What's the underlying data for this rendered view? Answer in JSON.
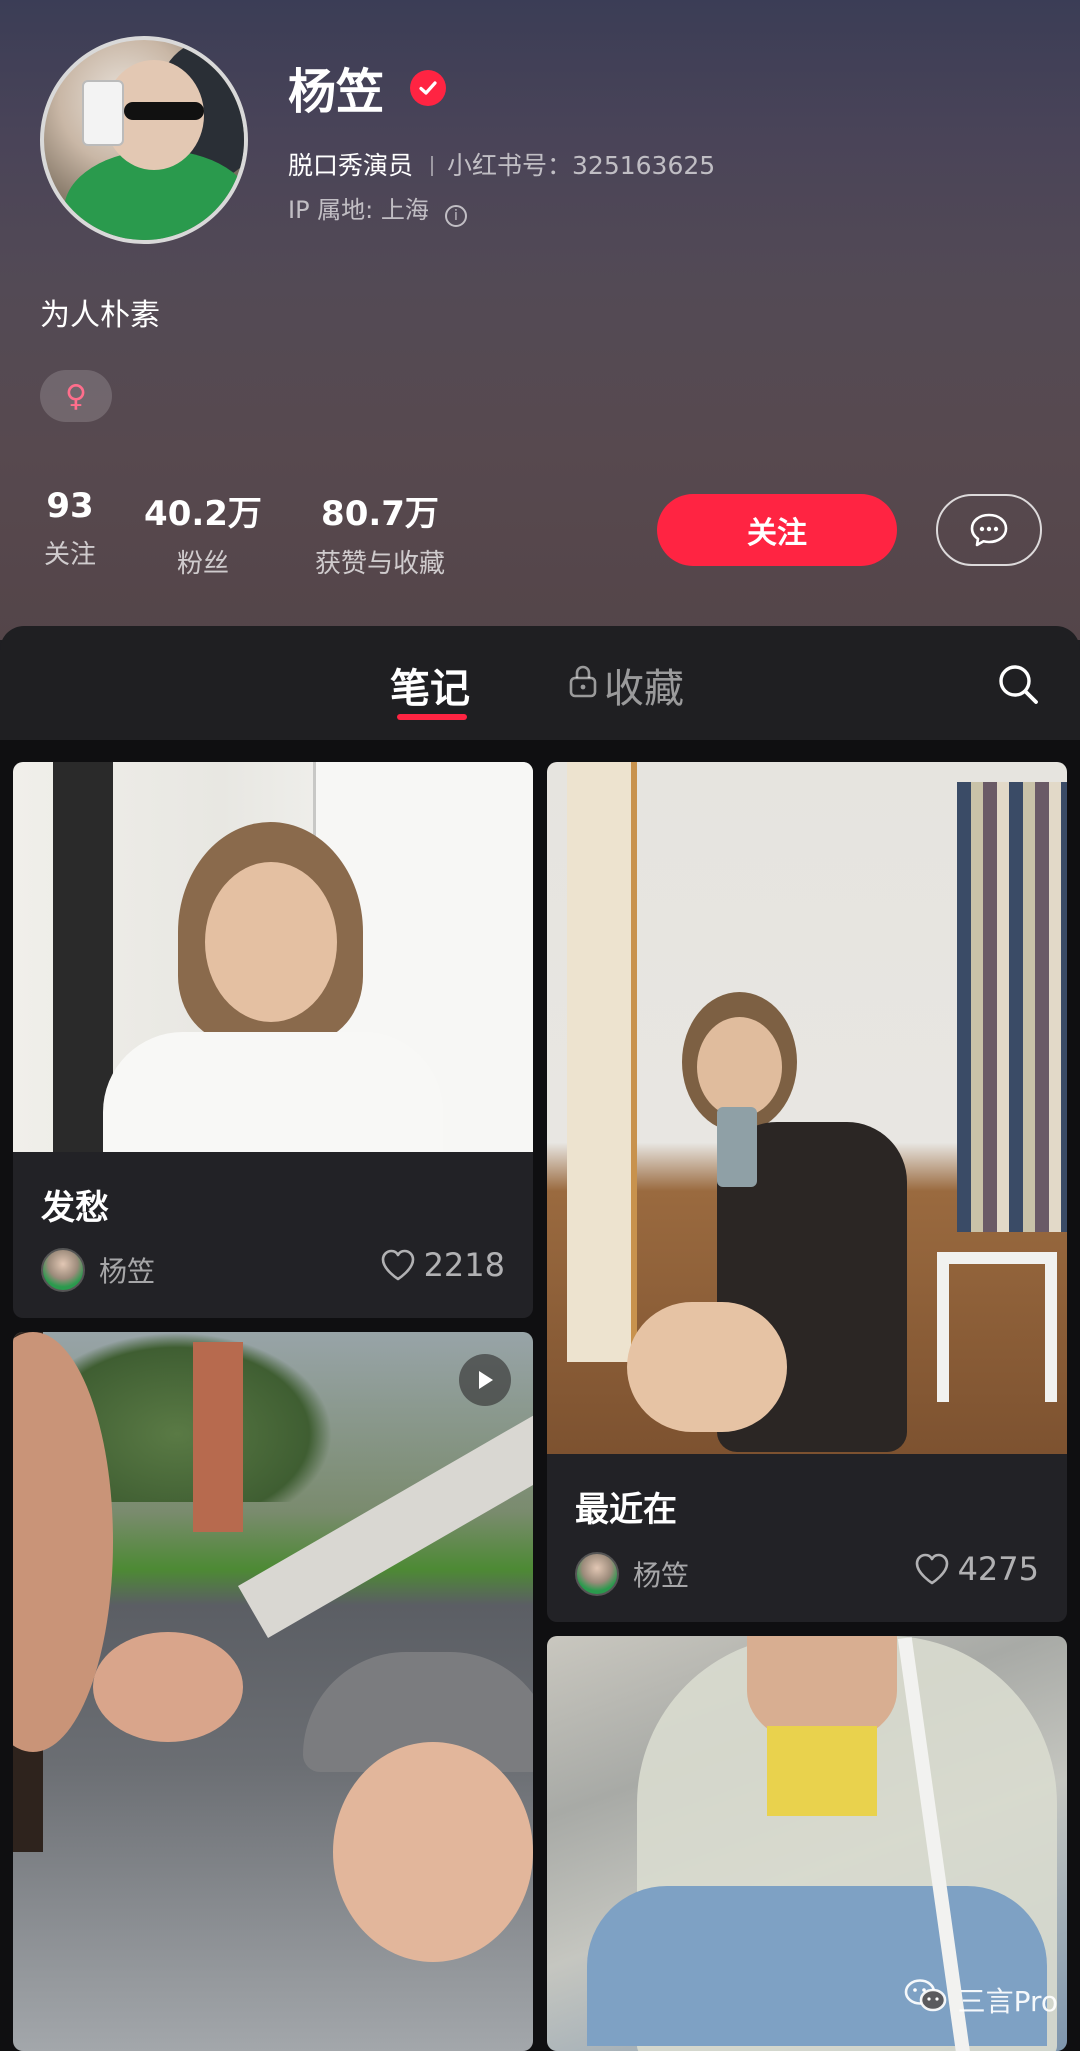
{
  "profile": {
    "name": "杨笠",
    "title": "脱口秀演员",
    "id_label": "小红书号：325163625",
    "ip_location": "IP 属地: 上海",
    "bio": "为人朴素",
    "gender_symbol": "♀"
  },
  "stats": [
    {
      "value": "93",
      "label": "关注"
    },
    {
      "value": "40.2万",
      "label": "粉丝"
    },
    {
      "value": "80.7万",
      "label": "获赞与收藏"
    }
  ],
  "actions": {
    "follow_label": "关注"
  },
  "tabs": {
    "notes": "笔记",
    "collections": "收藏"
  },
  "posts": [
    {
      "title": "发愁",
      "author": "杨笠",
      "likes": "2218",
      "type": "image"
    },
    {
      "title": "最近在",
      "author": "杨笠",
      "likes": "4275",
      "type": "image"
    },
    {
      "title": "",
      "author": "",
      "likes": "",
      "type": "video"
    },
    {
      "title": "",
      "author": "",
      "likes": "",
      "type": "image"
    }
  ],
  "watermark": "三言Pro",
  "colors": {
    "accent": "#ff2442",
    "background": "#1f1f22"
  }
}
